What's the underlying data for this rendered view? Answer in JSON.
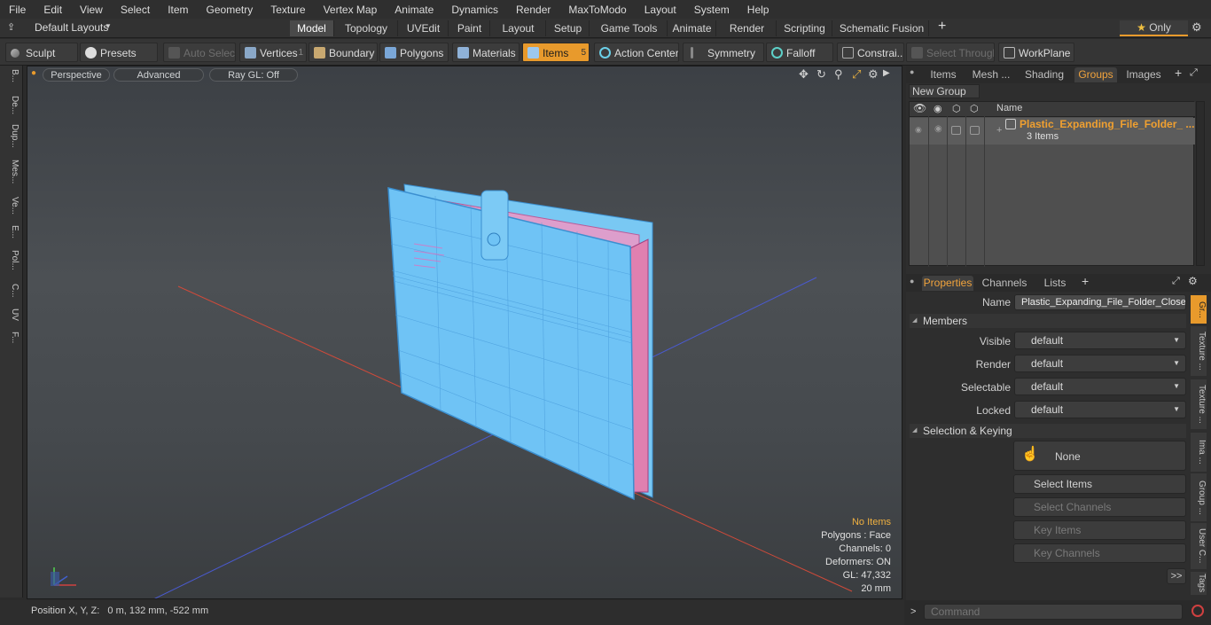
{
  "menu": [
    "File",
    "Edit",
    "View",
    "Select",
    "Item",
    "Geometry",
    "Texture",
    "Vertex Map",
    "Animate",
    "Dynamics",
    "Render",
    "MaxToModo",
    "Layout",
    "System",
    "Help"
  ],
  "layouts": {
    "label": "Default Layouts"
  },
  "mode_tabs": [
    "Model",
    "Topology",
    "UVEdit",
    "Paint",
    "Layout",
    "Setup",
    "Game Tools",
    "Animate",
    "Render",
    "Scripting",
    "Schematic Fusion"
  ],
  "only_label": "Only",
  "toolbar": {
    "sculpt": "Sculpt",
    "presets": "Presets",
    "auto_select": "Auto Select",
    "vertices": "Vertices",
    "vertices_count": "1",
    "boundary": "Boundary",
    "polygons": "Polygons",
    "materials": "Materials",
    "items": "Items",
    "items_count": "5",
    "action_center": "Action Center",
    "symmetry": "Symmetry",
    "falloff": "Falloff",
    "constraints": "Constrai...",
    "select_through": "Select Through",
    "workplane": "WorkPlane"
  },
  "left_tabs": [
    "B...",
    "De...",
    "Dup...",
    "Mes...",
    "Ve...",
    "E...",
    "Pol...",
    "C...",
    "UV",
    "F..."
  ],
  "viewport": {
    "perspective": "Perspective",
    "advanced": "Advanced",
    "raygl": "Ray GL: Off",
    "stats": {
      "items": "No Items",
      "polygons": "Polygons : Face",
      "channels": "Channels: 0",
      "deformers": "Deformers: ON",
      "gl": "GL: 47,332",
      "scale": "20 mm"
    }
  },
  "status": {
    "position": "Position X, Y, Z:   0 m, 132 mm, -522 mm"
  },
  "right": {
    "tabs": [
      "Items",
      "Mesh ...",
      "Shading",
      "Groups",
      "Images"
    ],
    "new_group": "New Group",
    "name_header": "Name",
    "group": {
      "name": "Plastic_Expanding_File_Folder_ ...",
      "count": "3 Items"
    },
    "prop_tabs": [
      "Properties",
      "Channels",
      "Lists"
    ],
    "name_label": "Name",
    "name_value": "Plastic_Expanding_File_Folder_Closed",
    "members_label": "Members",
    "visible_label": "Visible",
    "visible_value": "default",
    "render_label": "Render",
    "render_value": "default",
    "selectable_label": "Selectable",
    "selectable_value": "default",
    "locked_label": "Locked",
    "locked_value": "default",
    "sel_keying_label": "Selection & Keying",
    "none_label": "None",
    "select_items": "Select Items",
    "select_channels": "Select Channels",
    "key_items": "Key Items",
    "key_channels": "Key Channels",
    "more": ">>",
    "side_tabs": [
      "Gr...",
      "Texture ...",
      "Texture ...",
      "Ima ...",
      "Group ...",
      "User C...",
      "Tags"
    ],
    "command_placeholder": "Command"
  },
  "colors": {
    "accent": "#e89a2c",
    "folder": "#6fc3f5",
    "folder_edge": "#3b8fd0",
    "paper": "#e06aa6"
  }
}
